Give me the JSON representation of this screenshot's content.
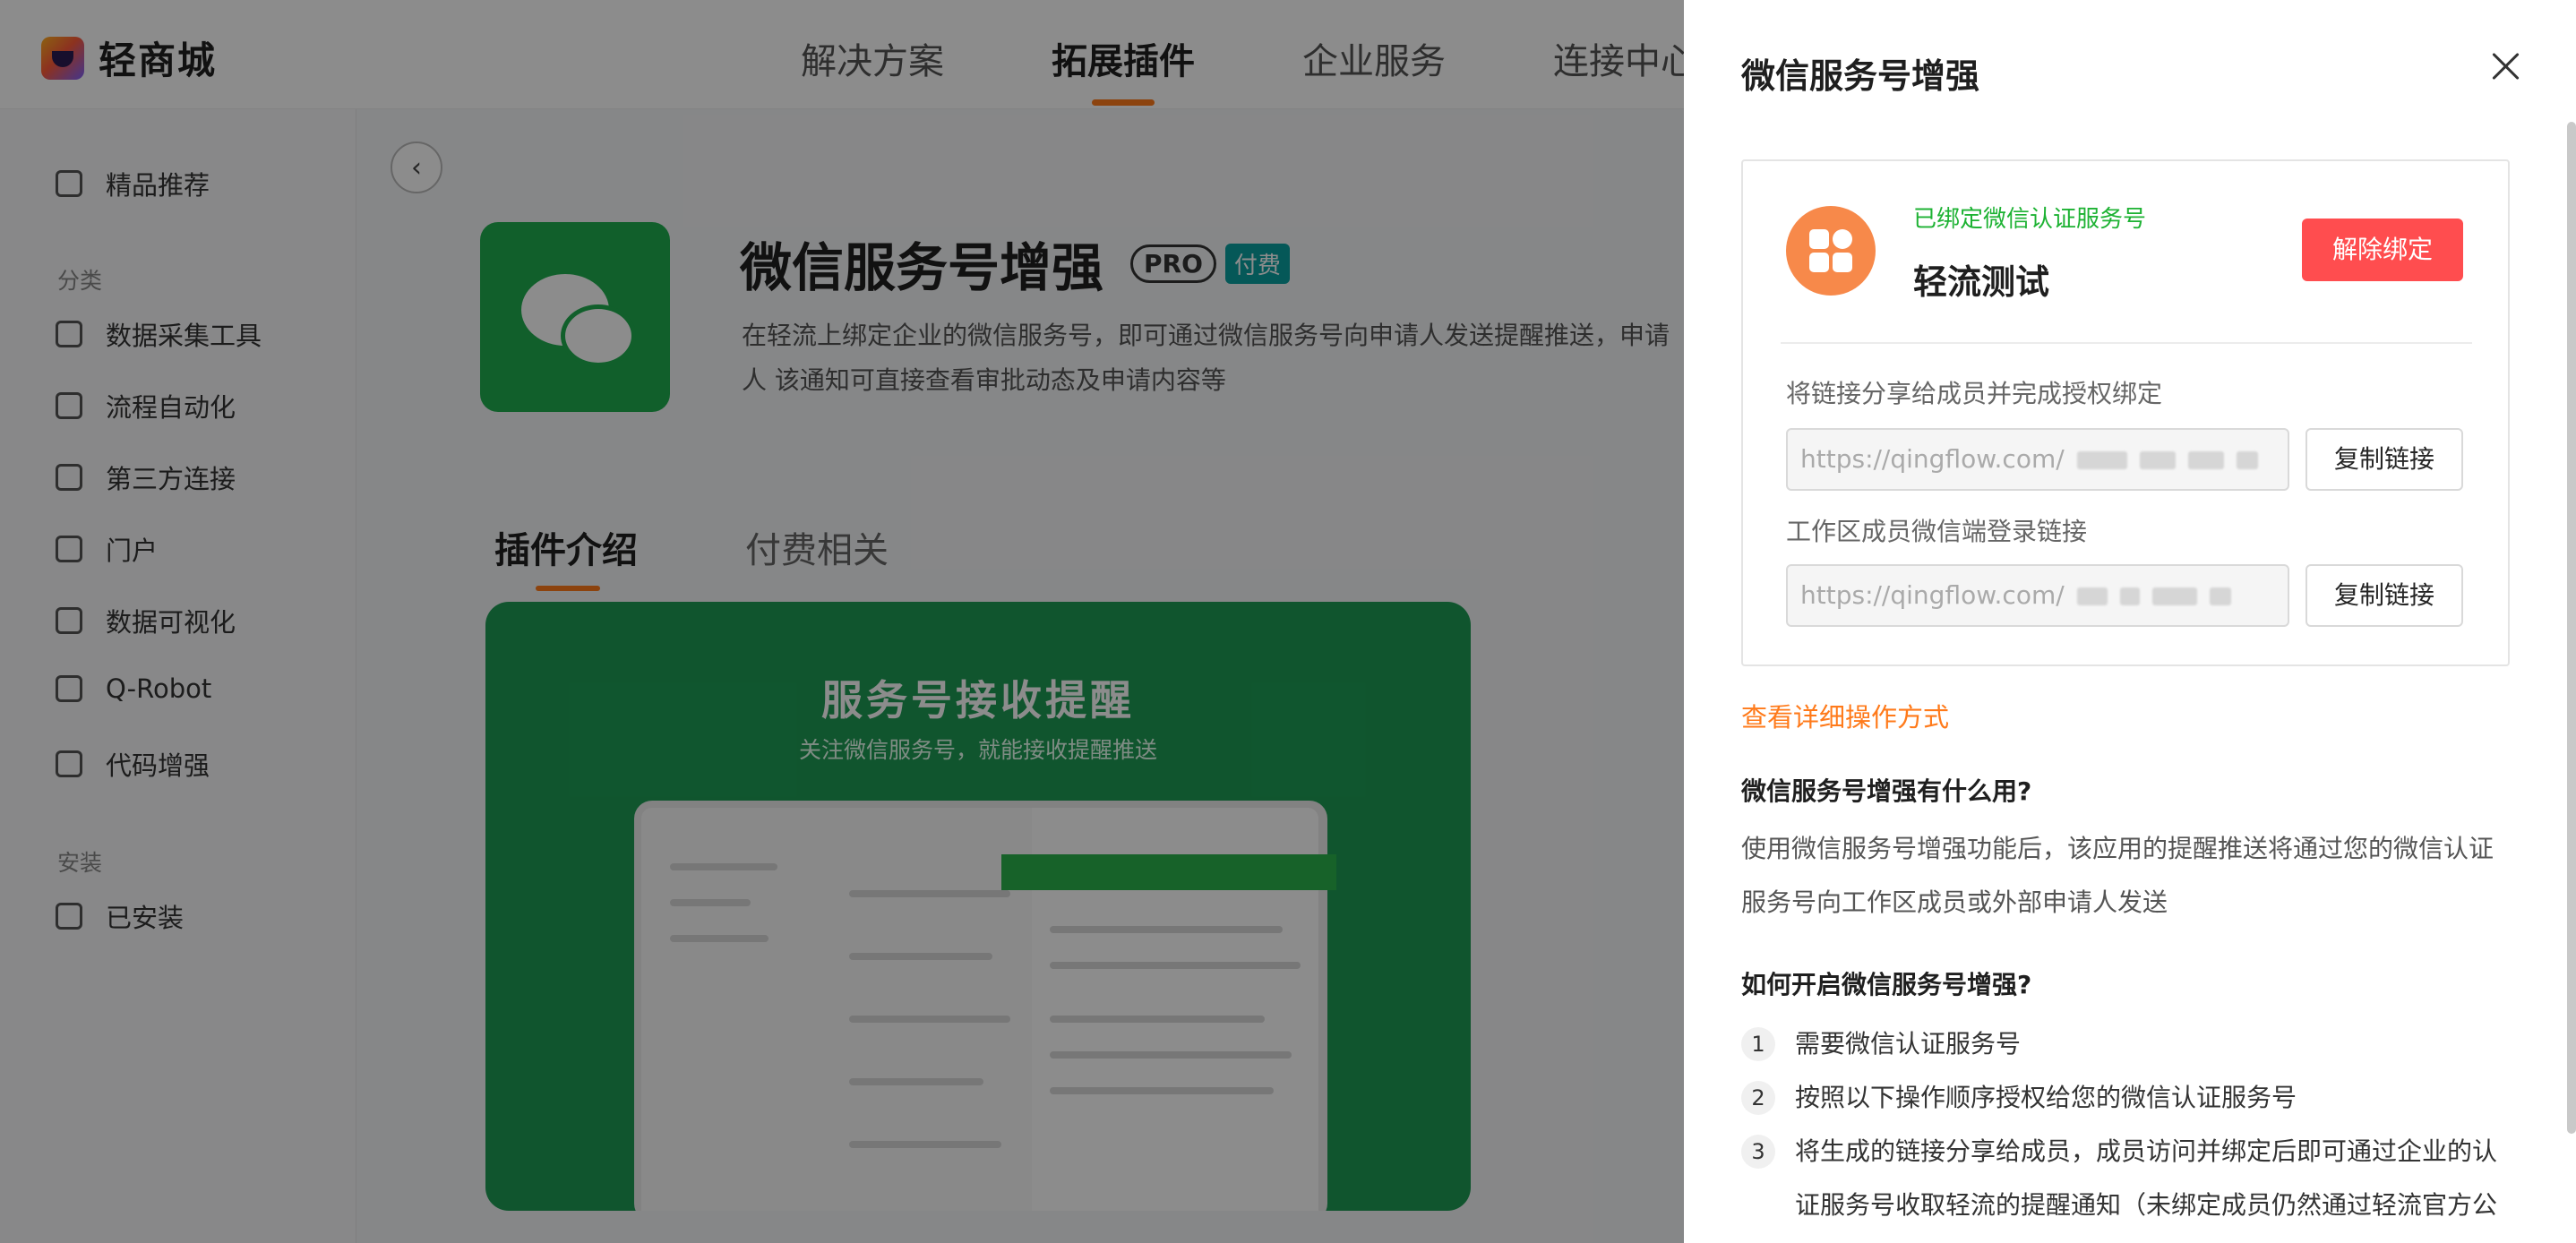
{
  "app": {
    "name": "轻商城",
    "nav": [
      "解决方案",
      "拓展插件",
      "企业服务",
      "连接中心"
    ]
  },
  "sidebar": {
    "top_item": "精品推荐",
    "group_category": "分类",
    "items": [
      "数据采集工具",
      "流程自动化",
      "第三方连接",
      "门户",
      "数据可视化",
      "Q-Robot",
      "代码增强"
    ],
    "group_install": "安装",
    "installed": "已安装"
  },
  "plugin": {
    "name": "微信服务号增强",
    "pro_badge": "PRO",
    "paid_badge": "付费",
    "description": "在轻流上绑定企业的微信服务号，即可通过微信服务号向申请人发送提醒推送，申请人 该通知可直接查看审批动态及申请内容等",
    "tabs": [
      "插件介绍",
      "付费相关"
    ],
    "banner_title": "服务号接收提醒",
    "banner_subtitle": "关注微信服务号，就能接收提醒推送"
  },
  "drawer": {
    "title": "微信服务号增强",
    "bind_status": "已绑定微信认证服务号",
    "account_name": "轻流测试",
    "unbind_label": "解除绑定",
    "share_label": "将链接分享给成员并完成授权绑定",
    "share_link": "https://qingflow.com/",
    "member_login_label": "工作区成员微信端登录链接",
    "member_login_link": "https://qingflow.com/",
    "copy_label": "复制链接",
    "detail_link": "查看详细操作方式",
    "q1": "微信服务号增强有什么用?",
    "a1": "使用微信服务号增强功能后，该应用的提醒推送将通过您的微信认证服务号向工作区成员或外部申请人发送",
    "q2": "如何开启微信服务号增强?",
    "steps": [
      {
        "num": "1",
        "text": "需要微信认证服务号"
      },
      {
        "num": "2",
        "text": "按照以下操作顺序授权给您的微信认证服务号"
      },
      {
        "num": "3",
        "text": "将生成的链接分享给成员，成员访问并绑定后即可通过企业的认证服务号收取轻流的提醒通知（未绑定成员仍然通过轻流官方公"
      }
    ]
  },
  "colors": {
    "accent": "#ff7a1a",
    "success": "#1db233",
    "danger": "#ff4d4f",
    "wechat_green": "#1fae4f"
  }
}
